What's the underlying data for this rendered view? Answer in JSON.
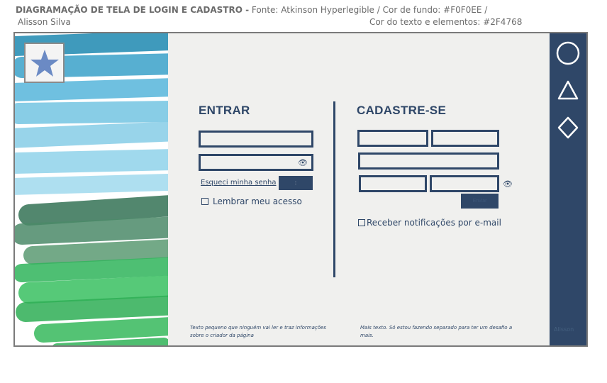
{
  "header": {
    "title": "DIAGRAMAÇÃO DE TELA DE LOGIN E CADASTRO -",
    "font_info": "Fonte: Atkinson Hyperlegible /",
    "bg_color_info": "Cor de fundo: #F0F0EE /",
    "author": "Alisson Silva",
    "text_color_info": "Cor do texto e elementos: #2F4768"
  },
  "colors": {
    "background": "#F0F0EE",
    "elements": "#2F4768"
  },
  "logo": {
    "icon": "star-icon"
  },
  "login": {
    "title": "ENTRAR",
    "username_value": "",
    "password_value": "",
    "password_toggle_icon": "eye-icon",
    "forgot_link": "Esqueci minha senha",
    "submit_label": ":",
    "remember_label": "Lembrar meu acesso",
    "remember_checked": false
  },
  "signup": {
    "title": "CADASTRE-SE",
    "first_name_value": "",
    "last_name_value": "",
    "email_value": "",
    "password_value": "",
    "confirm_password_value": "",
    "password_toggle_icon": "eye-icon",
    "submit_label": "Enviar",
    "notify_label": "Receber notificações por e-mail",
    "notify_checked": false
  },
  "footer": {
    "left_text": "Texto pequeno que ninguém vai ler e traz informações sobre o criador da página",
    "right_text": "Mais texto. Só estou fazendo separado para ter um desafio a mais."
  },
  "sidebar": {
    "icons": [
      "circle-icon",
      "triangle-icon",
      "diamond-icon"
    ],
    "bottom_text": "Alisson"
  }
}
